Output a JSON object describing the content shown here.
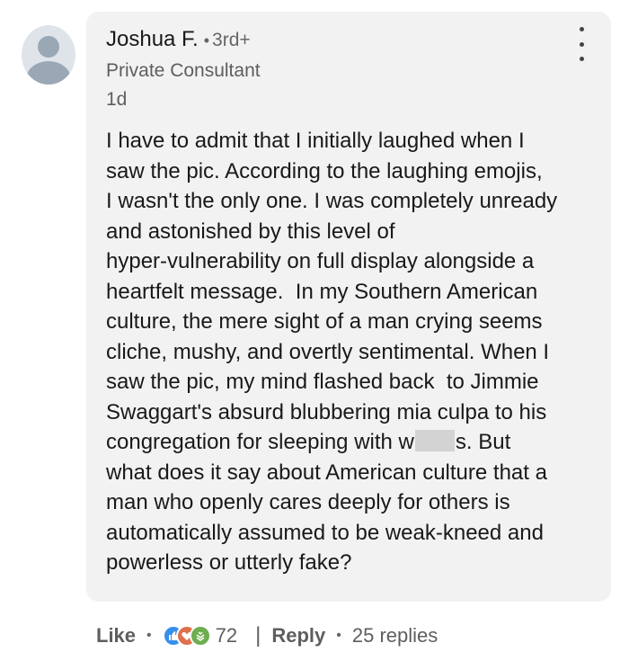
{
  "comment": {
    "author": {
      "name": "Joshua F.",
      "connection_degree": "3rd+",
      "headline": "Private Consultant",
      "time_ago": "1d"
    },
    "text_before_redaction": "I have to admit that I initially laughed when I\nsaw the pic. According to the laughing emojis,\nI wasn't the only one. I was completely unready\nand astonished by this level of\nhyper-vulnerability on full display alongside a\nheartfelt message.  In my Southern American\nculture, the mere sight of a man crying seems\ncliche, mushy, and overtly sentimental. When I\nsaw the pic, my mind flashed back  to Jimmie\nSwaggart's absurd blubbering mia culpa to his\ncongregation for sleeping with w",
    "text_after_redaction": "s. But\nwhat does it say about American culture that a\nman who openly cares deeply for others is\nautomatically assumed to be weak-kneed and\npowerless or utterly fake?"
  },
  "actions": {
    "like_label": "Like",
    "reaction_count": "72",
    "reply_label": "Reply",
    "replies_label": "25 replies",
    "reaction_icons": [
      "like-icon",
      "love-icon",
      "support-icon"
    ]
  },
  "colors": {
    "bubble_bg": "#f2f2f2",
    "text_primary": "#191919",
    "text_secondary": "#5e5e5e",
    "reaction_like": "#378fe9",
    "reaction_love": "#df704d",
    "reaction_support": "#6dae4f"
  }
}
